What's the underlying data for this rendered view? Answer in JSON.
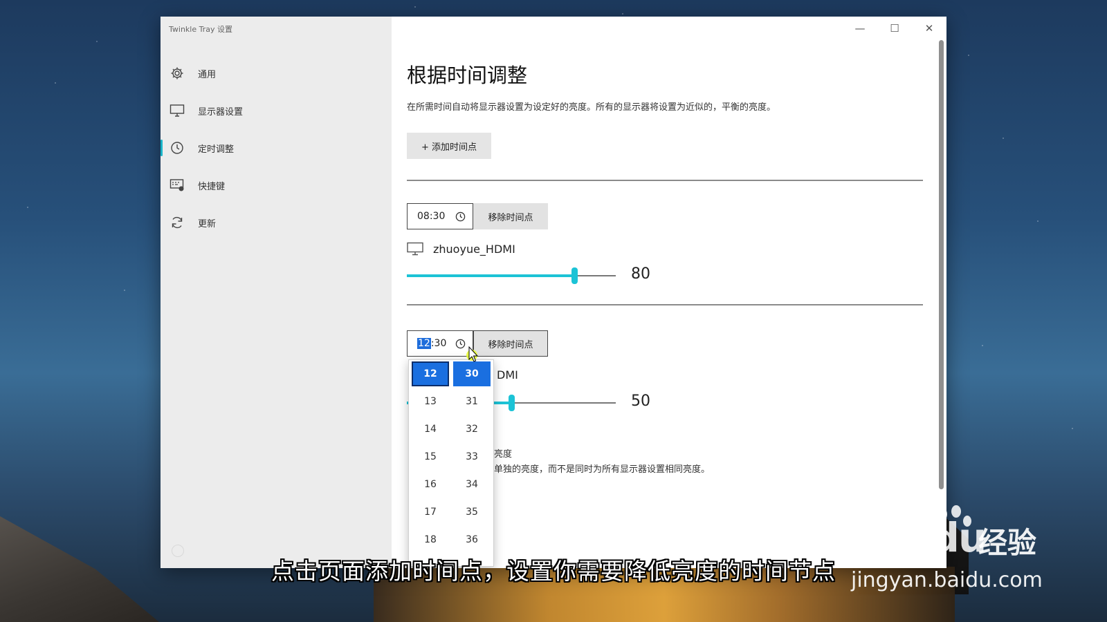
{
  "window": {
    "app_title": "Twinkle Tray 设置",
    "controls": {
      "minimize": "—",
      "maximize": "☐",
      "close": "✕"
    }
  },
  "sidebar": {
    "items": [
      {
        "label": "通用",
        "icon": "gear-icon"
      },
      {
        "label": "显示器设置",
        "icon": "monitor-icon"
      },
      {
        "label": "定时调整",
        "icon": "clock-icon",
        "active": true
      },
      {
        "label": "快捷键",
        "icon": "keyboard-shortcut-icon"
      },
      {
        "label": "更新",
        "icon": "refresh-icon"
      }
    ]
  },
  "main": {
    "title": "根据时间调整",
    "description": "在所需时间自动将显示器设置为设定好的亮度。所有的显示器将设置为近似的，平衡的亮度。",
    "add_button": "+ 添加时间点",
    "schedules": [
      {
        "time": "08:30",
        "remove_label": "移除时间点",
        "monitor": "zhuoyue_HDMI",
        "brightness": 80
      },
      {
        "time_hour": "12",
        "time_rest": ":30",
        "remove_label": "移除时间点",
        "monitor_partial": "DMI",
        "brightness": 50
      }
    ],
    "partial_setting_title": "亮度",
    "partial_setting_desc": "单独的亮度，而不是同时为所有显示器设置相同亮度。"
  },
  "time_picker": {
    "hours": [
      "12",
      "13",
      "14",
      "15",
      "16",
      "17",
      "18"
    ],
    "minutes": [
      "30",
      "31",
      "32",
      "33",
      "34",
      "35",
      "36"
    ],
    "selected_hour": "12",
    "selected_minute": "30"
  },
  "overlay": {
    "subtitle": "点击页面添加时间点，设置你需要降低亮度的时间节点",
    "watermark_brand": "Bai du",
    "watermark_cn": "经验",
    "watermark_url": "jingyan.baidu.com"
  },
  "colors": {
    "accent": "#1cc3d6",
    "selection": "#1a6fe0"
  }
}
